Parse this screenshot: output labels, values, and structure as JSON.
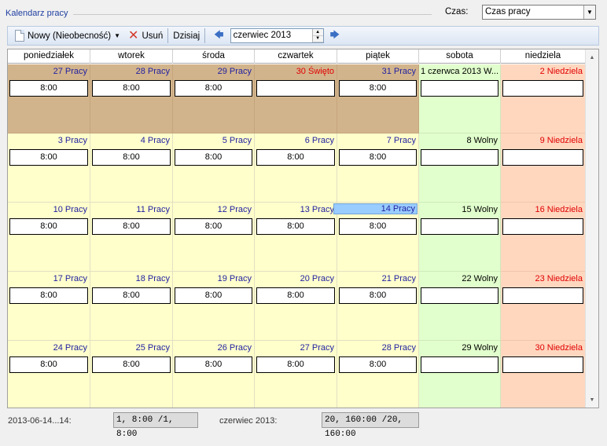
{
  "group_title": "Kalendarz pracy",
  "czas": {
    "label": "Czas:",
    "value": "Czas pracy"
  },
  "toolbar": {
    "new_label": "Nowy (Nieobecność)",
    "delete_label": "Usuń",
    "today_label": "Dzisiaj",
    "period": "czerwiec 2013"
  },
  "weekdays": [
    "poniedziałek",
    "wtorek",
    "środa",
    "czwartek",
    "piątek",
    "sobota",
    "niedziela"
  ],
  "weeks": [
    [
      {
        "label": "27 Pracy",
        "hours": "8:00",
        "type": "prev"
      },
      {
        "label": "28 Pracy",
        "hours": "8:00",
        "type": "prev"
      },
      {
        "label": "29 Pracy",
        "hours": "8:00",
        "type": "prev"
      },
      {
        "label": "30 Święto",
        "hours": "",
        "type": "prev hol"
      },
      {
        "label": "31 Pracy",
        "hours": "8:00",
        "type": "prev"
      },
      {
        "label": "1 czerwca 2013 W...",
        "hours": "",
        "type": "sat"
      },
      {
        "label": "2 Niedziela",
        "hours": "",
        "type": "sun"
      }
    ],
    [
      {
        "label": "3 Pracy",
        "hours": "8:00",
        "type": ""
      },
      {
        "label": "4 Pracy",
        "hours": "8:00",
        "type": ""
      },
      {
        "label": "5 Pracy",
        "hours": "8:00",
        "type": ""
      },
      {
        "label": "6 Pracy",
        "hours": "8:00",
        "type": ""
      },
      {
        "label": "7 Pracy",
        "hours": "8:00",
        "type": ""
      },
      {
        "label": "8 Wolny",
        "hours": "",
        "type": "sat plain"
      },
      {
        "label": "9 Niedziela",
        "hours": "",
        "type": "sun"
      }
    ],
    [
      {
        "label": "10 Pracy",
        "hours": "8:00",
        "type": ""
      },
      {
        "label": "11 Pracy",
        "hours": "8:00",
        "type": ""
      },
      {
        "label": "12 Pracy",
        "hours": "8:00",
        "type": ""
      },
      {
        "label": "13 Pracy",
        "hours": "8:00",
        "type": ""
      },
      {
        "label": "14 Pracy",
        "hours": "8:00",
        "type": "",
        "selected": true
      },
      {
        "label": "15 Wolny",
        "hours": "",
        "type": "sat plain"
      },
      {
        "label": "16 Niedziela",
        "hours": "",
        "type": "sun"
      }
    ],
    [
      {
        "label": "17 Pracy",
        "hours": "8:00",
        "type": ""
      },
      {
        "label": "18 Pracy",
        "hours": "8:00",
        "type": ""
      },
      {
        "label": "19 Pracy",
        "hours": "8:00",
        "type": ""
      },
      {
        "label": "20 Pracy",
        "hours": "8:00",
        "type": ""
      },
      {
        "label": "21 Pracy",
        "hours": "8:00",
        "type": ""
      },
      {
        "label": "22 Wolny",
        "hours": "",
        "type": "sat plain"
      },
      {
        "label": "23 Niedziela",
        "hours": "",
        "type": "sun"
      }
    ],
    [
      {
        "label": "24 Pracy",
        "hours": "8:00",
        "type": ""
      },
      {
        "label": "25 Pracy",
        "hours": "8:00",
        "type": ""
      },
      {
        "label": "26 Pracy",
        "hours": "8:00",
        "type": ""
      },
      {
        "label": "27 Pracy",
        "hours": "8:00",
        "type": ""
      },
      {
        "label": "28 Pracy",
        "hours": "8:00",
        "type": ""
      },
      {
        "label": "29 Wolny",
        "hours": "",
        "type": "sat plain"
      },
      {
        "label": "30 Niedziela",
        "hours": "",
        "type": "sun"
      }
    ]
  ],
  "footer": {
    "selected_range": "2013-06-14...14:",
    "selected_totals": "1, 8:00 /1, 8:00",
    "month_label": "czerwiec 2013:",
    "month_totals": "20, 160:00 /20, 160:00"
  },
  "colors": {
    "work_day": "#ffffcc",
    "previous_month": "#d2b48c",
    "saturday": "#e1ffcc",
    "sunday": "#ffd7bf",
    "selected": "#99ccff"
  }
}
